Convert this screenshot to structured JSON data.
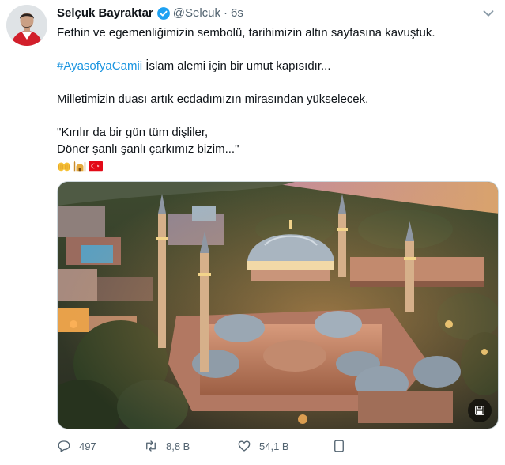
{
  "tweet": {
    "author_name": "Selçuk Bayraktar",
    "handle": "@Selcuk",
    "separator": "·",
    "time": "6s",
    "verified": true,
    "lines": {
      "l1": "Fethin ve egemenliğimizin sembolü, tarihimizin altın sayfasına kavuştuk.",
      "hashtag": "#AyasofyaCamii",
      "l2_rest": " İslam alemi için bir umut kapısıdır...",
      "l3": "Milletimizin duası artık ecdadımızın mirasından yükselecek.",
      "l4": "\"Kırılır da bir gün tüm dişliler,",
      "l5": "Döner şanlı şanlı çarkımız bizim...\""
    },
    "emojis": [
      "open-hands-icon",
      "mosque-icon",
      "turkey-flag-icon"
    ],
    "media_icon": "media-save-icon",
    "actions": {
      "reply_count": "497",
      "retweet_count": "8,8 B",
      "like_count": "54,1 B"
    },
    "colors": {
      "link": "#1b95e0",
      "verified": "#1da1f2",
      "secondary_text": "#536471",
      "flag_red": "#e30a17"
    }
  }
}
